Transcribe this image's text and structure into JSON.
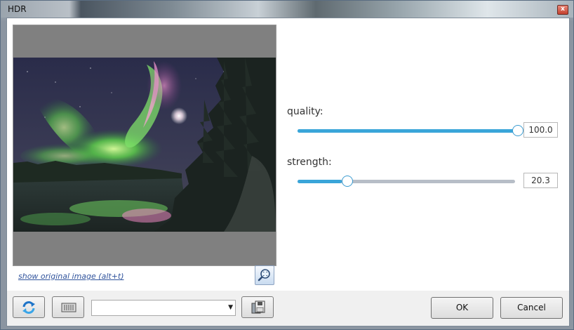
{
  "window": {
    "title": "HDR"
  },
  "titlebar": {
    "close_glyph": "x"
  },
  "preview": {
    "link_label": "show original image (alt+t)",
    "zoom_icon": "zoom-fit-icon"
  },
  "controls": [
    {
      "label": "quality:",
      "value": "100.0",
      "fraction": 1.0
    },
    {
      "label": "strength:",
      "value": "20.3",
      "fraction": 0.203
    }
  ],
  "colors": {
    "slider_accent": "#3aa5d9",
    "slider_track": "#b7bec7"
  },
  "footer": {
    "combo_value": "",
    "ok_label": "OK",
    "cancel_label": "Cancel",
    "icons": [
      "refresh-icon",
      "film-strip-icon",
      "save-icon"
    ]
  }
}
